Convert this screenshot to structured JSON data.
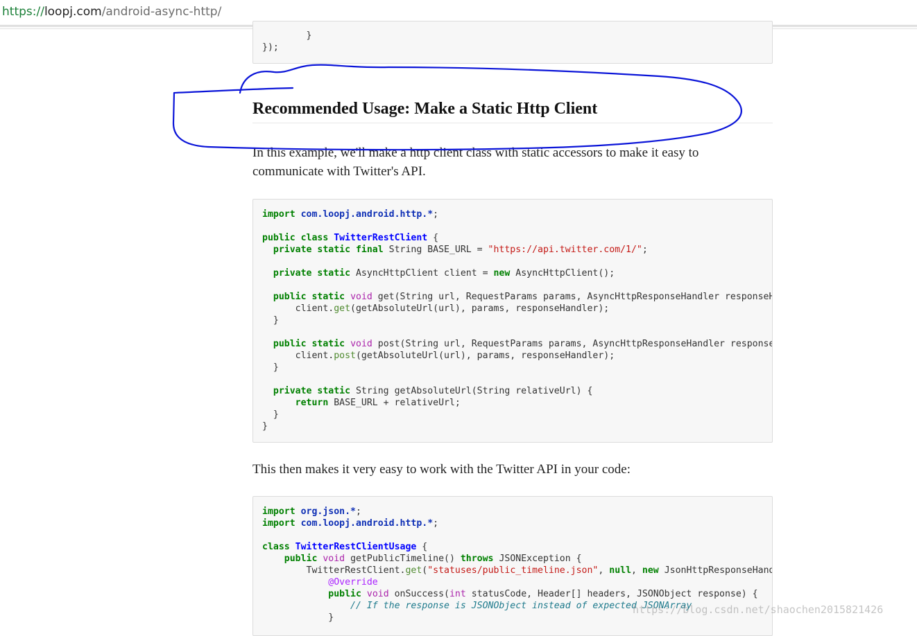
{
  "browser": {
    "url_scheme": "https://",
    "url_host": "loopj.com",
    "url_path": "/android-async-http/"
  },
  "top_snippet": {
    "line1": "        }",
    "line2": "});"
  },
  "section": {
    "heading": "Recommended Usage: Make a Static Http Client",
    "intro": "In this example, we'll make a http client class with static accessors to make it easy to communicate with Twitter's API.",
    "followup": "This then makes it very easy to work with the Twitter API in your code:"
  },
  "code1": {
    "l1_kw": "import",
    "l1_pkg": "com.loopj.android.http.*",
    "l1_end": ";",
    "l3_kw": "public class",
    "l3_cls": "TwitterRestClient",
    "l3_end": " {",
    "l4_kw": "private static final",
    "l4_mid": " String BASE_URL = ",
    "l4_str": "\"https://api.twitter.com/1/\"",
    "l4_end": ";",
    "l6_kw": "private static",
    "l6_mid": " AsyncHttpClient client = ",
    "l6_new": "new",
    "l6_end": " AsyncHttpClient();",
    "l8_kw": "public static",
    "l8_ty": "void",
    "l8_end": " get(String url, RequestParams params, AsyncHttpResponseHandler responseHandler) {",
    "l9_pre": "client.",
    "l9_m": "get",
    "l9_end": "(getAbsoluteUrl(url), params, responseHandler);",
    "l12_kw": "public static",
    "l12_ty": "void",
    "l12_end": " post(String url, RequestParams params, AsyncHttpResponseHandler responseHandler) {",
    "l13_pre": "client.",
    "l13_m": "post",
    "l13_end": "(getAbsoluteUrl(url), params, responseHandler);",
    "l16_kw": "private static",
    "l16_end": " String getAbsoluteUrl(String relativeUrl) {",
    "l17_kw": "return",
    "l17_end": " BASE_URL + relativeUrl;",
    "close_inner": "}",
    "close_outer": "}"
  },
  "code2": {
    "l1_kw": "import",
    "l1_pkg": "org.json.*",
    "l1_end": ";",
    "l2_kw": "import",
    "l2_pkg": "com.loopj.android.http.*",
    "l2_end": ";",
    "l4_kw": "class",
    "l4_cls": "TwitterRestClientUsage",
    "l4_end": " {",
    "l5_kw": "public",
    "l5_ty": "void",
    "l5_mid": " getPublicTimeline() ",
    "l5_kw2": "throws",
    "l5_end": " JSONException {",
    "l6_pre": "TwitterRestClient.",
    "l6_m": "get",
    "l6_str": "\"statuses/public_timeline.json\"",
    "l6_mid": ", ",
    "l6_null": "null",
    "l6_new": "new",
    "l6_end": " JsonHttpResponseHandler() {",
    "l7_ann": "@Override",
    "l8_kw": "public",
    "l8_ty": "void",
    "l8_mid": " onSuccess(",
    "l8_ty2": "int",
    "l8_end": " statusCode, Header[] headers, JSONObject response) {",
    "l9_cmt": "// If the response is JSONObject instead of expected JSONArray",
    "l10": "}"
  },
  "watermark": "https://blog.csdn.net/shaochen2015821426",
  "colors": {
    "annotation_stroke": "#0a14d8",
    "keyword": "#008000",
    "class_name": "#0000ff"
  }
}
